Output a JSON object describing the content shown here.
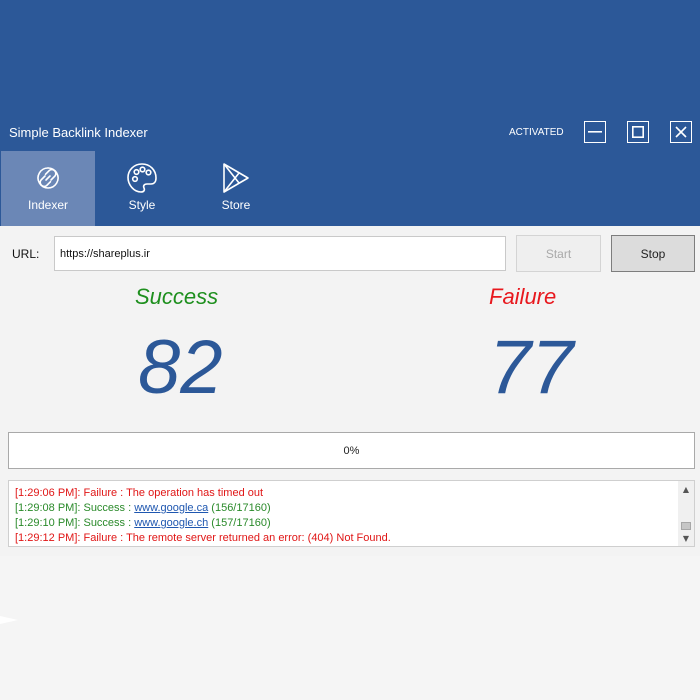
{
  "window": {
    "title": "Simple Backlink Indexer",
    "status": "ACTIVATED",
    "controls": [
      "minimize-icon",
      "maximize-icon",
      "close-icon"
    ]
  },
  "tabs": [
    {
      "label": "Indexer",
      "icon": "link-icon",
      "active": true
    },
    {
      "label": "Style",
      "icon": "palette-icon",
      "active": false
    },
    {
      "label": "Store",
      "icon": "play-store-icon",
      "active": false
    }
  ],
  "form": {
    "url_label": "URL:",
    "url_value": "https://shareplus.ir",
    "start_label": "Start",
    "stop_label": "Stop"
  },
  "stats": {
    "success_label": "Success",
    "success_value": "82",
    "failure_label": "Failure",
    "failure_value": "77"
  },
  "progress": {
    "percent": 0,
    "label": "0%"
  },
  "log": [
    {
      "type": "failure",
      "prefix": "[1:29:06 PM]: Failure : The operation has timed out",
      "link": "",
      "suffix": ""
    },
    {
      "type": "success",
      "prefix": "[1:29:08 PM]: Success : ",
      "link": "www.google.ca",
      "suffix": " (156/17160)"
    },
    {
      "type": "success",
      "prefix": "[1:29:10 PM]: Success : ",
      "link": "www.google.ch",
      "suffix": " (157/17160)"
    },
    {
      "type": "failure",
      "prefix": "[1:29:12 PM]: Failure : The remote server returned an error: (404) Not Found.",
      "link": "",
      "suffix": ""
    }
  ],
  "colors": {
    "header_bg": "#2c5898",
    "tab_active_bg": "#6b87b6",
    "success": "#1e8f1e",
    "failure": "#e8181e",
    "count": "#2c5898",
    "link": "#1f57b0"
  }
}
